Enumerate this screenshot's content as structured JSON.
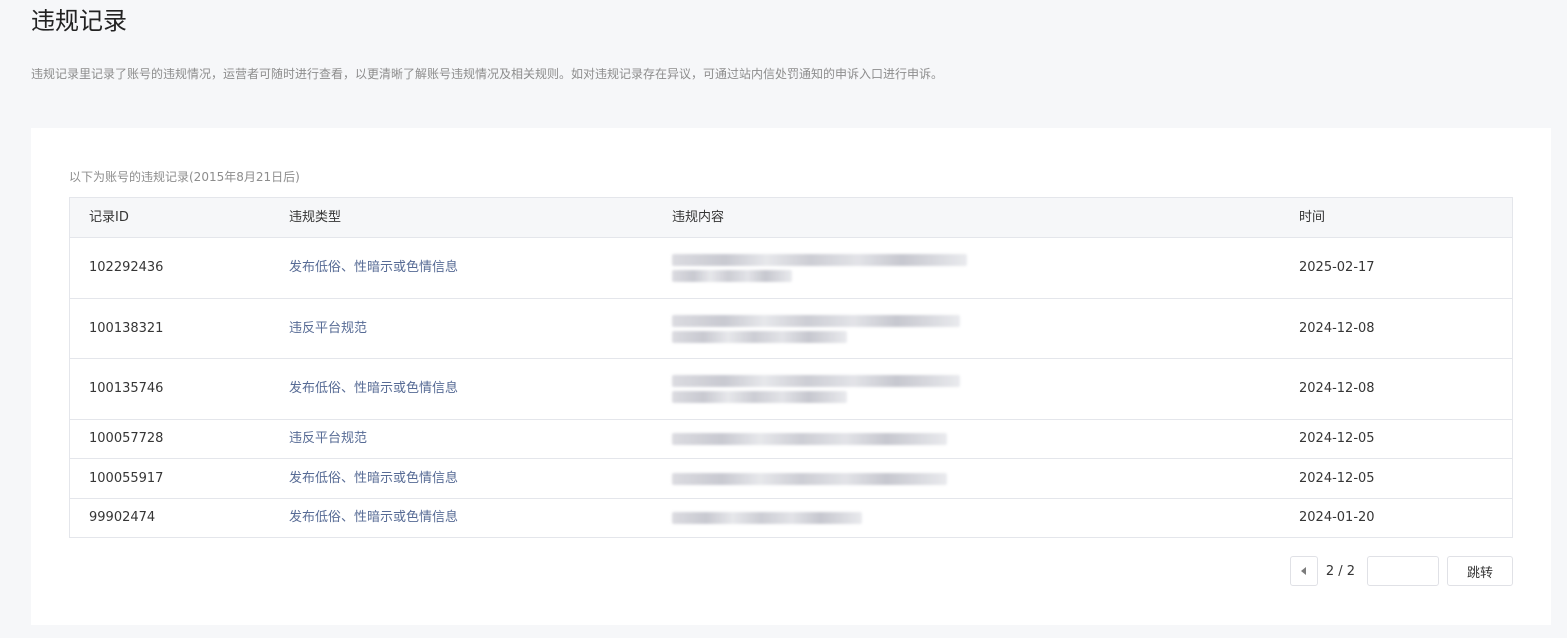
{
  "page": {
    "title": "违规记录",
    "description": "违规记录里记录了账号的违规情况，运营者可随时进行查看，以更清晰了解账号违规情况及相关规则。如对违规记录存在异议，可通过站内信处罚通知的申诉入口进行申诉。"
  },
  "table": {
    "caption": "以下为账号的违规记录(2015年8月21日后)",
    "columns": {
      "id": "记录ID",
      "type": "违规类型",
      "content": "违规内容",
      "time": "时间"
    },
    "rows": [
      {
        "id": "102292436",
        "type": "发布低俗、性暗示或色情信息",
        "time": "2025-02-17"
      },
      {
        "id": "100138321",
        "type": "违反平台规范",
        "time": "2024-12-08"
      },
      {
        "id": "100135746",
        "type": "发布低俗、性暗示或色情信息",
        "time": "2024-12-08"
      },
      {
        "id": "100057728",
        "type": "违反平台规范",
        "time": "2024-12-05"
      },
      {
        "id": "100055917",
        "type": "发布低俗、性暗示或色情信息",
        "time": "2024-12-05"
      },
      {
        "id": "99902474",
        "type": "发布低俗、性暗示或色情信息",
        "time": "2024-01-20"
      }
    ]
  },
  "pager": {
    "info": "2 / 2",
    "input_value": "",
    "go_label": "跳转",
    "prev_icon": "caret-left-icon"
  },
  "colors": {
    "background": "#f6f7f9",
    "panel": "#ffffff",
    "link": "#576b95",
    "muted_text": "#8d8d8d",
    "border": "#e4e6eb"
  }
}
